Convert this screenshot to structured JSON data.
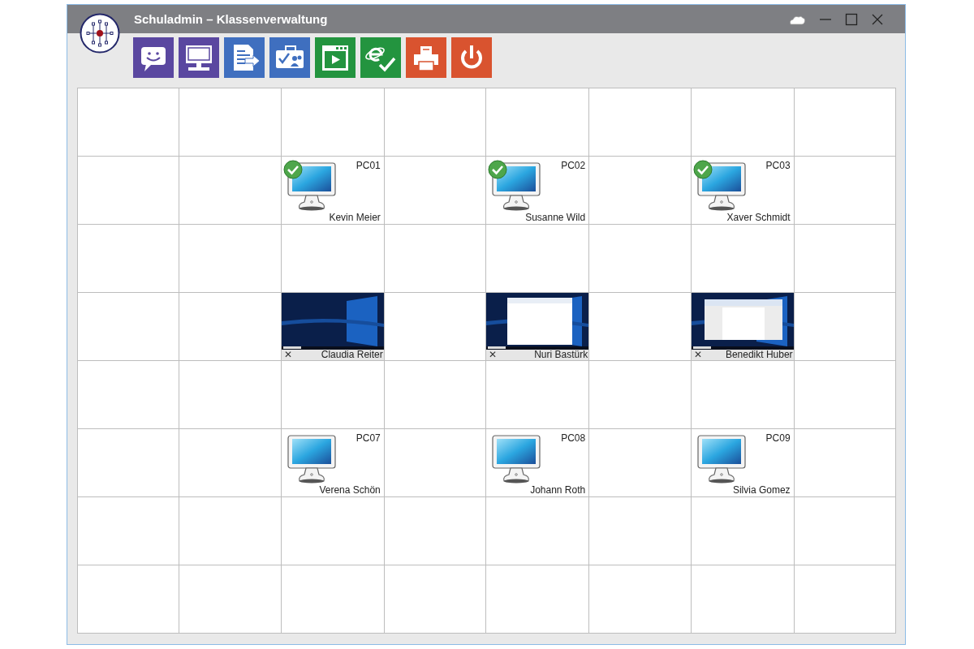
{
  "window": {
    "title": "Schuladmin – Klassenverwaltung"
  },
  "toolbar": [
    {
      "kind": "chat",
      "color": "#5a47a0"
    },
    {
      "kind": "monitor",
      "color": "#5a47a0"
    },
    {
      "kind": "document",
      "color": "#3f6fbf"
    },
    {
      "kind": "checklist",
      "color": "#3f6fbf"
    },
    {
      "kind": "player",
      "color": "#23943f"
    },
    {
      "kind": "browser",
      "color": "#23943f"
    },
    {
      "kind": "printer",
      "color": "#d9532f"
    },
    {
      "kind": "power",
      "color": "#d9532f"
    }
  ],
  "grid": {
    "rows": [
      {
        "cells": [
          {
            "kind": "empty"
          },
          {
            "kind": "empty"
          },
          {
            "kind": "empty"
          },
          {
            "kind": "empty"
          },
          {
            "kind": "empty"
          },
          {
            "kind": "empty"
          },
          {
            "kind": "empty"
          },
          {
            "kind": "empty"
          }
        ]
      },
      {
        "cells": [
          {
            "kind": "empty"
          },
          {
            "kind": "empty"
          },
          {
            "kind": "pc",
            "label": "PC01",
            "user": "Kevin Meier",
            "online": true
          },
          {
            "kind": "empty"
          },
          {
            "kind": "pc",
            "label": "PC02",
            "user": "Susanne Wild",
            "online": true
          },
          {
            "kind": "empty"
          },
          {
            "kind": "pc",
            "label": "PC03",
            "user": "Xaver Schmidt",
            "online": true
          },
          {
            "kind": "empty"
          }
        ]
      },
      {
        "cells": [
          {
            "kind": "empty"
          },
          {
            "kind": "empty"
          },
          {
            "kind": "empty"
          },
          {
            "kind": "empty"
          },
          {
            "kind": "empty"
          },
          {
            "kind": "empty"
          },
          {
            "kind": "empty"
          },
          {
            "kind": "empty"
          }
        ]
      },
      {
        "cells": [
          {
            "kind": "empty"
          },
          {
            "kind": "empty"
          },
          {
            "kind": "desktop",
            "user": "Claudia Reiter",
            "close": "✕"
          },
          {
            "kind": "empty"
          },
          {
            "kind": "paint",
            "user": "Nuri Bastürk",
            "close": "✕"
          },
          {
            "kind": "empty"
          },
          {
            "kind": "writer",
            "user": "Benedikt Huber",
            "close": "✕"
          },
          {
            "kind": "empty"
          }
        ]
      },
      {
        "cells": [
          {
            "kind": "empty"
          },
          {
            "kind": "empty"
          },
          {
            "kind": "empty"
          },
          {
            "kind": "empty"
          },
          {
            "kind": "empty"
          },
          {
            "kind": "empty"
          },
          {
            "kind": "empty"
          },
          {
            "kind": "empty"
          }
        ]
      },
      {
        "cells": [
          {
            "kind": "empty"
          },
          {
            "kind": "empty"
          },
          {
            "kind": "pc",
            "label": "PC07",
            "user": "Verena Schön",
            "online": false
          },
          {
            "kind": "empty"
          },
          {
            "kind": "pc",
            "label": "PC08",
            "user": "Johann Roth",
            "online": false
          },
          {
            "kind": "empty"
          },
          {
            "kind": "pc",
            "label": "PC09",
            "user": "Silvia Gomez",
            "online": false
          },
          {
            "kind": "empty"
          }
        ]
      },
      {
        "cells": [
          {
            "kind": "empty"
          },
          {
            "kind": "empty"
          },
          {
            "kind": "empty"
          },
          {
            "kind": "empty"
          },
          {
            "kind": "empty"
          },
          {
            "kind": "empty"
          },
          {
            "kind": "empty"
          },
          {
            "kind": "empty"
          }
        ]
      },
      {
        "cells": [
          {
            "kind": "empty"
          },
          {
            "kind": "empty"
          },
          {
            "kind": "empty"
          },
          {
            "kind": "empty"
          },
          {
            "kind": "empty"
          },
          {
            "kind": "empty"
          },
          {
            "kind": "empty"
          },
          {
            "kind": "empty"
          }
        ]
      }
    ]
  }
}
